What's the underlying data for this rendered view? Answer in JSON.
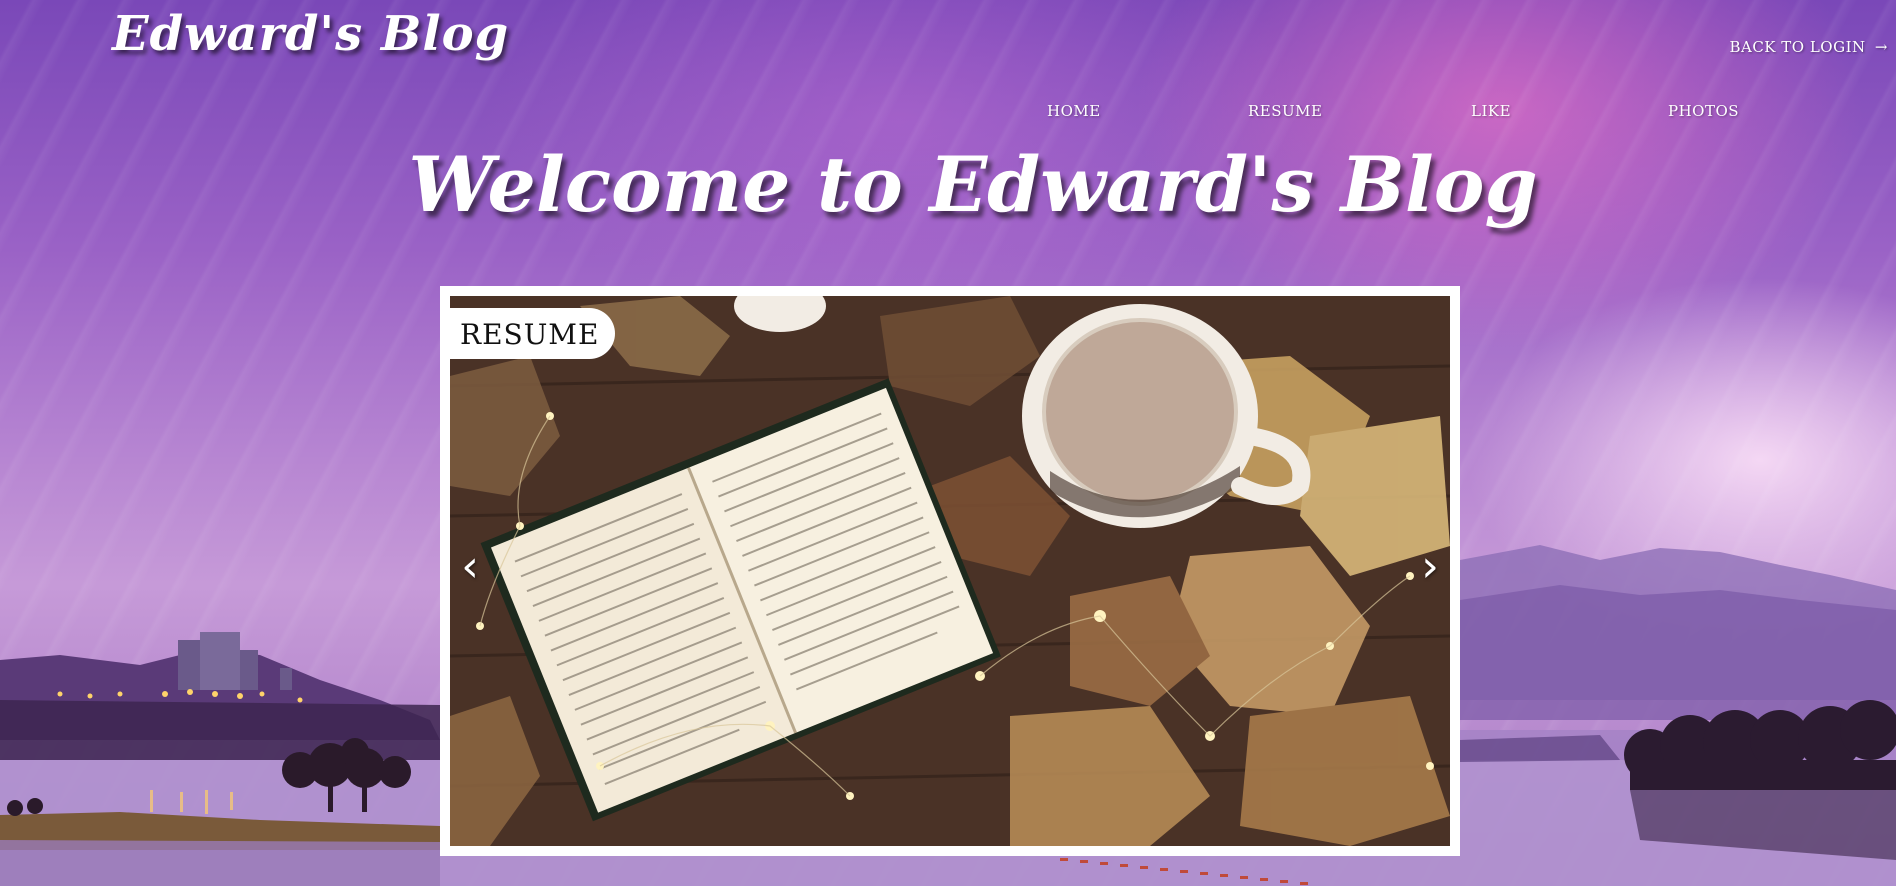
{
  "site": {
    "brand": "Edward's Blog",
    "back_login": "BACK TO LOGIN",
    "back_login_icon": "arrow-right-icon"
  },
  "nav": {
    "items": [
      {
        "label": "HOME"
      },
      {
        "label": "RESUME"
      },
      {
        "label": "LIKE"
      },
      {
        "label": "PHOTOS"
      }
    ]
  },
  "hero": {
    "title": "Welcome to Edward's Blog"
  },
  "carousel": {
    "badge": "RESUME",
    "prev_icon": "chevron-left-icon",
    "next_icon": "chevron-right-icon"
  },
  "colors": {
    "sky_top": "#7a48b8",
    "sky_pink": "#ff78c8",
    "frame": "#ffffff"
  }
}
